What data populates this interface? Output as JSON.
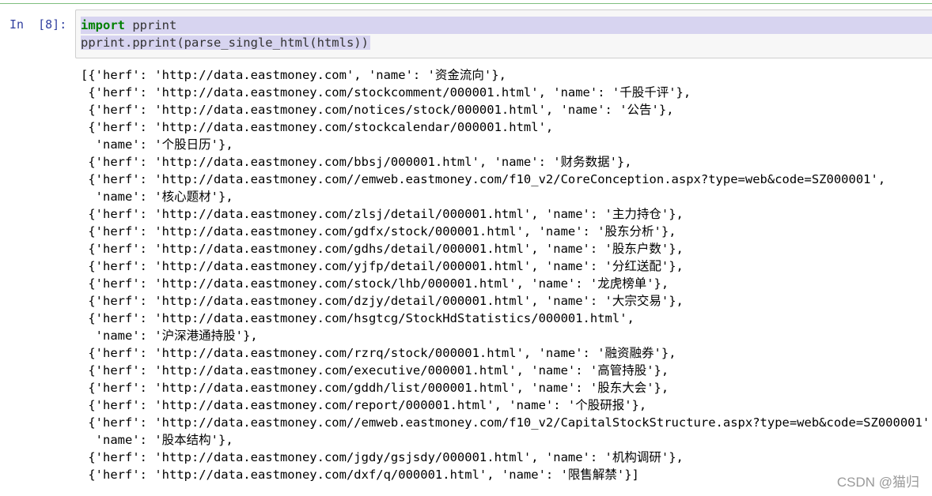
{
  "cell": {
    "prompt": "In  [8]:",
    "code": {
      "line1_keyword": "import",
      "line1_rest": " pprint",
      "line2": "pprint.pprint(parse_single_html(htmls))"
    }
  },
  "output_lines": [
    "[{'herf': 'http://data.eastmoney.com', 'name': '资金流向'},",
    " {'herf': 'http://data.eastmoney.com/stockcomment/000001.html', 'name': '千股千评'},",
    " {'herf': 'http://data.eastmoney.com/notices/stock/000001.html', 'name': '公告'},",
    " {'herf': 'http://data.eastmoney.com/stockcalendar/000001.html',",
    "  'name': '个股日历'},",
    " {'herf': 'http://data.eastmoney.com/bbsj/000001.html', 'name': '财务数据'},",
    " {'herf': 'http://data.eastmoney.com//emweb.eastmoney.com/f10_v2/CoreConception.aspx?type=web&code=SZ000001',",
    "  'name': '核心题材'},",
    " {'herf': 'http://data.eastmoney.com/zlsj/detail/000001.html', 'name': '主力持仓'},",
    " {'herf': 'http://data.eastmoney.com/gdfx/stock/000001.html', 'name': '股东分析'},",
    " {'herf': 'http://data.eastmoney.com/gdhs/detail/000001.html', 'name': '股东户数'},",
    " {'herf': 'http://data.eastmoney.com/yjfp/detail/000001.html', 'name': '分红送配'},",
    " {'herf': 'http://data.eastmoney.com/stock/lhb/000001.html', 'name': '龙虎榜单'},",
    " {'herf': 'http://data.eastmoney.com/dzjy/detail/000001.html', 'name': '大宗交易'},",
    " {'herf': 'http://data.eastmoney.com/hsgtcg/StockHdStatistics/000001.html',",
    "  'name': '沪深港通持股'},",
    " {'herf': 'http://data.eastmoney.com/rzrq/stock/000001.html', 'name': '融资融券'},",
    " {'herf': 'http://data.eastmoney.com/executive/000001.html', 'name': '高管持股'},",
    " {'herf': 'http://data.eastmoney.com/gddh/list/000001.html', 'name': '股东大会'},",
    " {'herf': 'http://data.eastmoney.com/report/000001.html', 'name': '个股研报'},",
    " {'herf': 'http://data.eastmoney.com//emweb.eastmoney.com/f10_v2/CapitalStockStructure.aspx?type=web&code=SZ000001',",
    "  'name': '股本结构'},",
    " {'herf': 'http://data.eastmoney.com/jgdy/gsjsdy/000001.html', 'name': '机构调研'},",
    " {'herf': 'http://data.eastmoney.com/dxf/q/000001.html', 'name': '限售解禁'}]"
  ],
  "watermark": "CSDN @猫归"
}
